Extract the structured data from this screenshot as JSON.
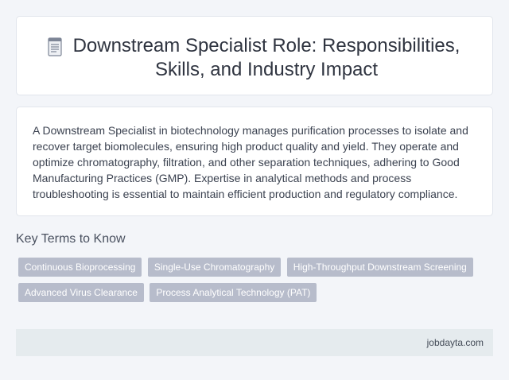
{
  "header": {
    "icon": "document-icon",
    "title_line1": "Downstream Specialist Role: Responsibilities,",
    "title_line2": "Skills, and Industry Impact"
  },
  "intro": {
    "text": "A Downstream Specialist in biotechnology manages purification processes to isolate and recover target biomolecules, ensuring high product quality and yield. They operate and optimize chromatography, filtration, and other separation techniques, adhering to Good Manufacturing Practices (GMP). Expertise in analytical methods and process troubleshooting is essential to maintain efficient production and regulatory compliance."
  },
  "key_terms": {
    "heading": "Key Terms to Know",
    "tags": [
      "Continuous Bioprocessing",
      "Single-Use Chromatography",
      "High-Throughput Downstream Screening",
      "Advanced Virus Clearance",
      "Process Analytical Technology (PAT)"
    ]
  },
  "footer": {
    "site": "jobdayta.com"
  },
  "colors": {
    "background": "#f3f5f9",
    "tag_bg": "#b7bccb",
    "footer_bg": "#e5ebee"
  }
}
